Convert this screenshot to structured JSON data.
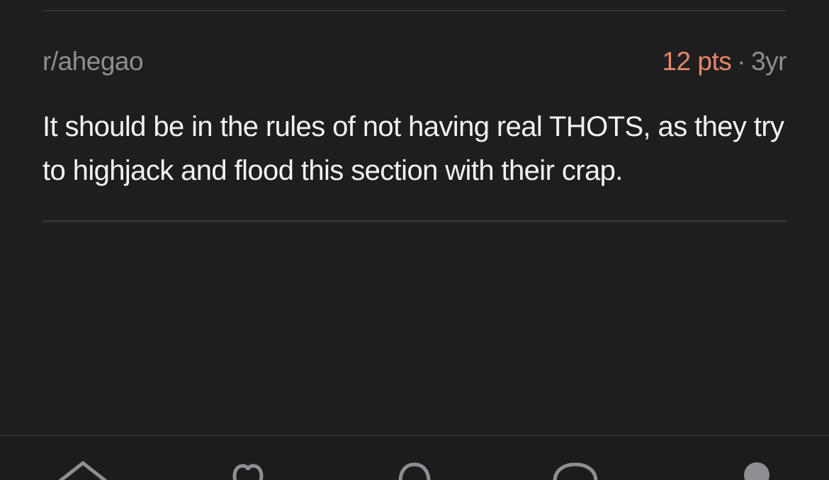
{
  "comment": {
    "subreddit": "r/ahegao",
    "points": "12 pts",
    "separator": "·",
    "age": "3yr",
    "body": "It should be in the rules of not having real THOTS, as they try to highjack and flood this section with their crap."
  },
  "tabbar": {
    "tabs": [
      {
        "icon": "home-icon"
      },
      {
        "icon": "heart-icon"
      },
      {
        "icon": "search-icon"
      },
      {
        "icon": "chat-icon"
      },
      {
        "icon": "profile-icon"
      }
    ]
  },
  "colors": {
    "background": "#1e1e1f",
    "points": "#e5876a",
    "meta": "#8e8e93",
    "text": "#f2f2f4"
  }
}
